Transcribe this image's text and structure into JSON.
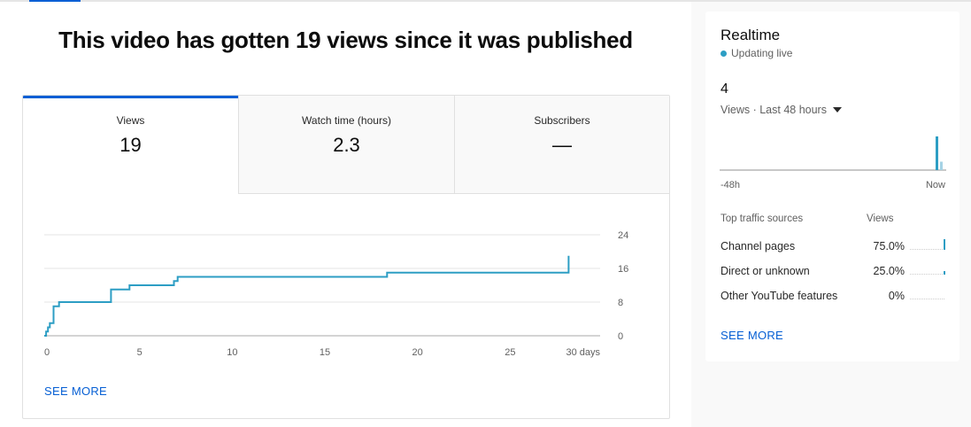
{
  "headline": "This video has gotten 19 views since it was published",
  "tabs": [
    {
      "label": "Views",
      "value": "19"
    },
    {
      "label": "Watch time (hours)",
      "value": "2.3"
    },
    {
      "label": "Subscribers",
      "value": "—"
    }
  ],
  "chart_data": {
    "type": "line",
    "title": "",
    "xlabel": "",
    "ylabel": "",
    "x_ticks": [
      "0",
      "5",
      "10",
      "15",
      "20",
      "25",
      "30 days"
    ],
    "y_ticks": [
      "0",
      "8",
      "16",
      "24"
    ],
    "xlim": [
      0,
      30
    ],
    "ylim": [
      0,
      24
    ],
    "grid": true,
    "series": [
      {
        "x": [
          0,
          0.1,
          0.1,
          0.2,
          0.2,
          0.3,
          0.3,
          0.5,
          0.5,
          0.8,
          0.8,
          3.6,
          3.6,
          4.6,
          4.6,
          7.0,
          7.0,
          7.2,
          7.2,
          18.5,
          18.5,
          28.3,
          28.3
        ],
        "y": [
          0,
          0,
          1,
          1,
          2,
          2,
          3,
          3,
          7,
          7,
          8,
          8,
          11,
          11,
          12,
          12,
          13,
          13,
          14,
          14,
          15,
          15,
          19
        ],
        "color": "#2d9ec4"
      }
    ]
  },
  "see_more_label": "SEE MORE",
  "realtime": {
    "title": "Realtime",
    "live_text": "Updating live",
    "count": "4",
    "metric_label": "Views · Last 48 hours",
    "axis_left": "-48h",
    "axis_right": "Now",
    "bars": {
      "latest_hour": 4,
      "current_hour": 1
    },
    "traffic": {
      "header": "Top traffic sources",
      "views_header": "Views",
      "rows": [
        {
          "name": "Channel pages",
          "pct": "75.0%",
          "value": 0.75
        },
        {
          "name": "Direct or unknown",
          "pct": "25.0%",
          "value": 0.25
        },
        {
          "name": "Other YouTube features",
          "pct": "0%",
          "value": 0
        }
      ]
    },
    "see_more_label": "SEE MORE"
  },
  "colors": {
    "accent": "#065fd4",
    "line": "#2d9ec4",
    "live": "#2d9ec4"
  }
}
